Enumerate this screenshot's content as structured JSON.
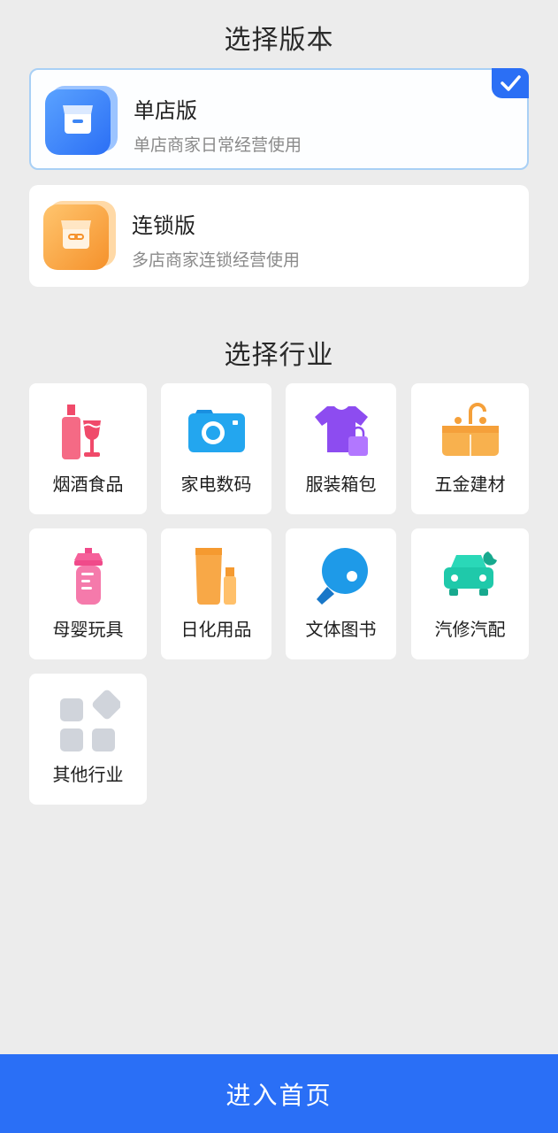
{
  "version_section": {
    "title": "选择版本",
    "options": [
      {
        "name": "单店版",
        "desc": "单店商家日常经营使用",
        "selected": true,
        "icon": "storefront-icon",
        "color": "#3d86f5"
      },
      {
        "name": "连锁版",
        "desc": "多店商家连锁经营使用",
        "selected": false,
        "icon": "chain-store-icon",
        "color": "#f7a03f"
      }
    ]
  },
  "industry_section": {
    "title": "选择行业",
    "items": [
      {
        "label": "烟酒食品",
        "icon": "wine-bottle-icon"
      },
      {
        "label": "家电数码",
        "icon": "camera-icon"
      },
      {
        "label": "服装箱包",
        "icon": "tshirt-bag-icon"
      },
      {
        "label": "五金建材",
        "icon": "faucet-sink-icon"
      },
      {
        "label": "母婴玩具",
        "icon": "baby-bottle-icon"
      },
      {
        "label": "日化用品",
        "icon": "cosmetics-tube-icon"
      },
      {
        "label": "文体图书",
        "icon": "ping-pong-icon"
      },
      {
        "label": "汽修汽配",
        "icon": "car-wrench-icon"
      },
      {
        "label": "其他行业",
        "icon": "grid-apps-icon"
      }
    ]
  },
  "footer": {
    "enter_label": "进入首页"
  },
  "colors": {
    "accent": "#2a6ff6",
    "background": "#ececec"
  }
}
